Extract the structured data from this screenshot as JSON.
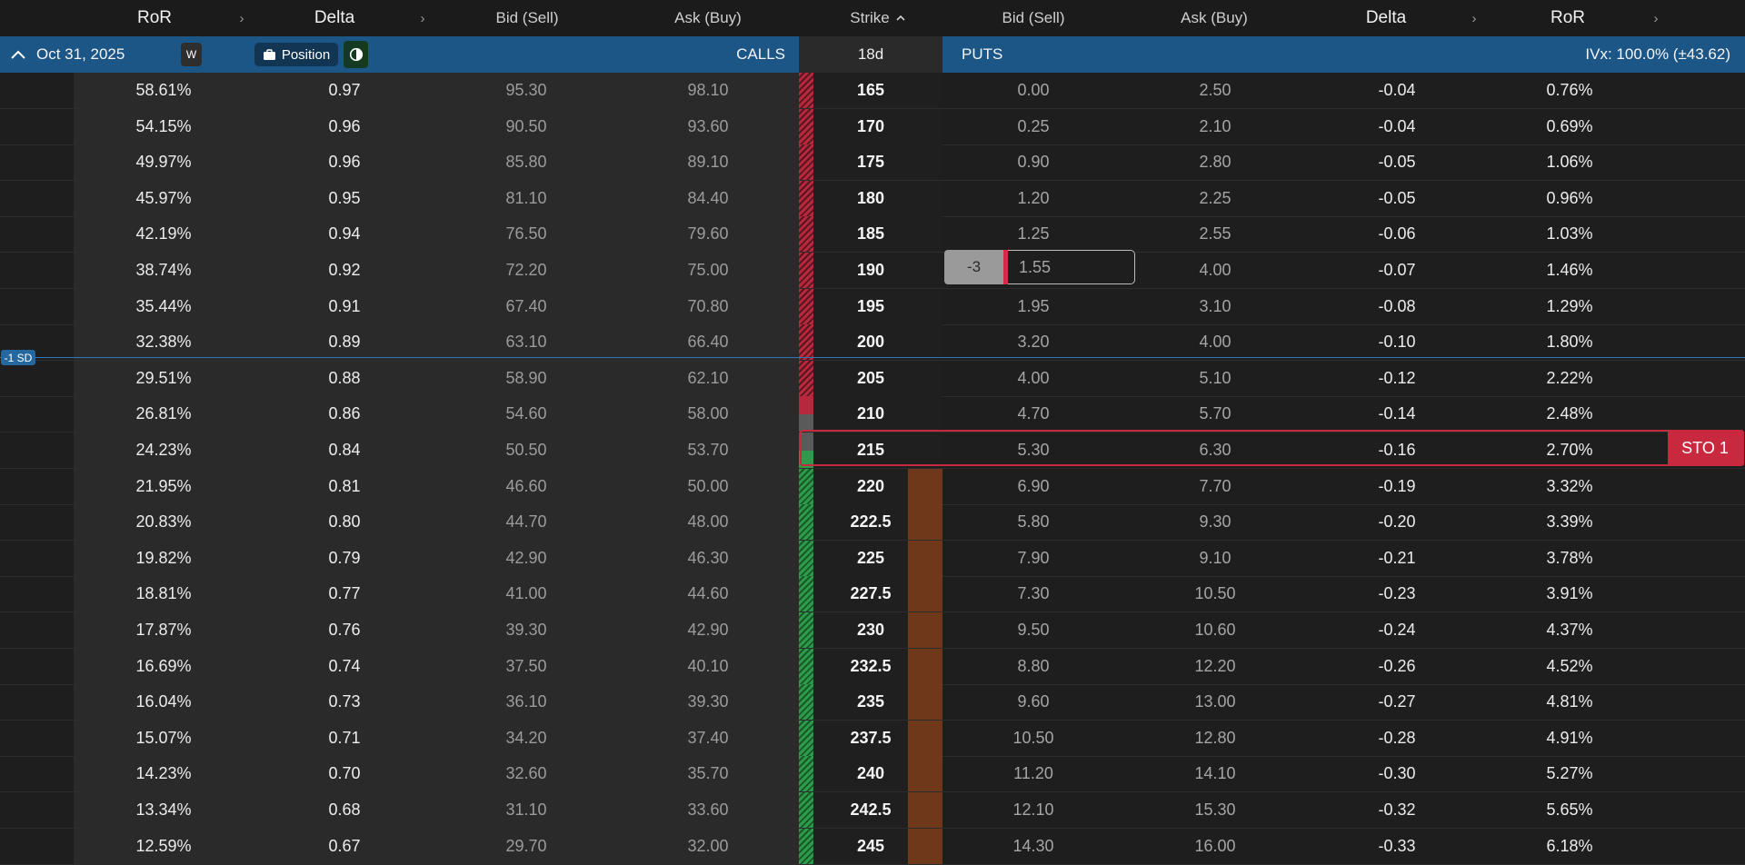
{
  "header": {
    "ror_left": "RoR",
    "delta_left": "Delta",
    "bid_left": "Bid (Sell)",
    "ask_left": "Ask (Buy)",
    "strike": "Strike",
    "strike_sort_icon": "chevron-up-icon",
    "bid_right": "Bid (Sell)",
    "ask_right": "Ask (Buy)",
    "delta_right": "Delta",
    "ror_right": "RoR",
    "arrow": "›"
  },
  "expiry_bar": {
    "collapse_icon": "chevron-up-icon",
    "date": "Oct 31, 2025",
    "weekly_badge": "W",
    "position_label": "Position",
    "contrast_icon": "contrast-icon",
    "calls_label": "CALLS",
    "days": "18d",
    "puts_label": "PUTS",
    "ivx": "IVx: 100.0% (±43.62)",
    "color": "#1c5687"
  },
  "sd_marker": "-1 SD",
  "order": {
    "quantity": "-3",
    "price": "1.55",
    "action": "STO 1"
  },
  "colors": {
    "itm_calls_hatch": "#b8283c",
    "otm_calls_hatch": "#2f9a4c",
    "position_bar": "#70381a",
    "selected_outline": "#c8293f"
  },
  "rows": [
    {
      "call_ror": "58.61%",
      "call_delta": "0.97",
      "call_bid": "95.30",
      "call_ask": "98.10",
      "strike": "165",
      "put_bid": "0.00",
      "put_ask": "2.50",
      "put_delta": "-0.04",
      "put_ror": "0.76%"
    },
    {
      "call_ror": "54.15%",
      "call_delta": "0.96",
      "call_bid": "90.50",
      "call_ask": "93.60",
      "strike": "170",
      "put_bid": "0.25",
      "put_ask": "2.10",
      "put_delta": "-0.04",
      "put_ror": "0.69%"
    },
    {
      "call_ror": "49.97%",
      "call_delta": "0.96",
      "call_bid": "85.80",
      "call_ask": "89.10",
      "strike": "175",
      "put_bid": "0.90",
      "put_ask": "2.80",
      "put_delta": "-0.05",
      "put_ror": "1.06%"
    },
    {
      "call_ror": "45.97%",
      "call_delta": "0.95",
      "call_bid": "81.10",
      "call_ask": "84.40",
      "strike": "180",
      "put_bid": "1.20",
      "put_ask": "2.25",
      "put_delta": "-0.05",
      "put_ror": "0.96%"
    },
    {
      "call_ror": "42.19%",
      "call_delta": "0.94",
      "call_bid": "76.50",
      "call_ask": "79.60",
      "strike": "185",
      "put_bid": "1.25",
      "put_ask": "2.55",
      "put_delta": "-0.06",
      "put_ror": "1.03%"
    },
    {
      "call_ror": "38.74%",
      "call_delta": "0.92",
      "call_bid": "72.20",
      "call_ask": "75.00",
      "strike": "190",
      "put_bid": "",
      "put_ask": "4.00",
      "put_delta": "-0.07",
      "put_ror": "1.46%"
    },
    {
      "call_ror": "35.44%",
      "call_delta": "0.91",
      "call_bid": "67.40",
      "call_ask": "70.80",
      "strike": "195",
      "put_bid": "1.95",
      "put_ask": "3.10",
      "put_delta": "-0.08",
      "put_ror": "1.29%"
    },
    {
      "call_ror": "32.38%",
      "call_delta": "0.89",
      "call_bid": "63.10",
      "call_ask": "66.40",
      "strike": "200",
      "put_bid": "3.20",
      "put_ask": "4.00",
      "put_delta": "-0.10",
      "put_ror": "1.80%"
    },
    {
      "call_ror": "29.51%",
      "call_delta": "0.88",
      "call_bid": "58.90",
      "call_ask": "62.10",
      "strike": "205",
      "put_bid": "4.00",
      "put_ask": "5.10",
      "put_delta": "-0.12",
      "put_ror": "2.22%"
    },
    {
      "call_ror": "26.81%",
      "call_delta": "0.86",
      "call_bid": "54.60",
      "call_ask": "58.00",
      "strike": "210",
      "put_bid": "4.70",
      "put_ask": "5.70",
      "put_delta": "-0.14",
      "put_ror": "2.48%"
    },
    {
      "call_ror": "24.23%",
      "call_delta": "0.84",
      "call_bid": "50.50",
      "call_ask": "53.70",
      "strike": "215",
      "put_bid": "5.30",
      "put_ask": "6.30",
      "put_delta": "-0.16",
      "put_ror": "2.70%"
    },
    {
      "call_ror": "21.95%",
      "call_delta": "0.81",
      "call_bid": "46.60",
      "call_ask": "50.00",
      "strike": "220",
      "put_bid": "6.90",
      "put_ask": "7.70",
      "put_delta": "-0.19",
      "put_ror": "3.32%"
    },
    {
      "call_ror": "20.83%",
      "call_delta": "0.80",
      "call_bid": "44.70",
      "call_ask": "48.00",
      "strike": "222.5",
      "put_bid": "5.80",
      "put_ask": "9.30",
      "put_delta": "-0.20",
      "put_ror": "3.39%"
    },
    {
      "call_ror": "19.82%",
      "call_delta": "0.79",
      "call_bid": "42.90",
      "call_ask": "46.30",
      "strike": "225",
      "put_bid": "7.90",
      "put_ask": "9.10",
      "put_delta": "-0.21",
      "put_ror": "3.78%"
    },
    {
      "call_ror": "18.81%",
      "call_delta": "0.77",
      "call_bid": "41.00",
      "call_ask": "44.60",
      "strike": "227.5",
      "put_bid": "7.30",
      "put_ask": "10.50",
      "put_delta": "-0.23",
      "put_ror": "3.91%"
    },
    {
      "call_ror": "17.87%",
      "call_delta": "0.76",
      "call_bid": "39.30",
      "call_ask": "42.90",
      "strike": "230",
      "put_bid": "9.50",
      "put_ask": "10.60",
      "put_delta": "-0.24",
      "put_ror": "4.37%"
    },
    {
      "call_ror": "16.69%",
      "call_delta": "0.74",
      "call_bid": "37.50",
      "call_ask": "40.10",
      "strike": "232.5",
      "put_bid": "8.80",
      "put_ask": "12.20",
      "put_delta": "-0.26",
      "put_ror": "4.52%"
    },
    {
      "call_ror": "16.04%",
      "call_delta": "0.73",
      "call_bid": "36.10",
      "call_ask": "39.30",
      "strike": "235",
      "put_bid": "9.60",
      "put_ask": "13.00",
      "put_delta": "-0.27",
      "put_ror": "4.81%"
    },
    {
      "call_ror": "15.07%",
      "call_delta": "0.71",
      "call_bid": "34.20",
      "call_ask": "37.40",
      "strike": "237.5",
      "put_bid": "10.50",
      "put_ask": "12.80",
      "put_delta": "-0.28",
      "put_ror": "4.91%"
    },
    {
      "call_ror": "14.23%",
      "call_delta": "0.70",
      "call_bid": "32.60",
      "call_ask": "35.70",
      "strike": "240",
      "put_bid": "11.20",
      "put_ask": "14.10",
      "put_delta": "-0.30",
      "put_ror": "5.27%"
    },
    {
      "call_ror": "13.34%",
      "call_delta": "0.68",
      "call_bid": "31.10",
      "call_ask": "33.60",
      "strike": "242.5",
      "put_bid": "12.10",
      "put_ask": "15.30",
      "put_delta": "-0.32",
      "put_ror": "5.65%"
    },
    {
      "call_ror": "12.59%",
      "call_delta": "0.67",
      "call_bid": "29.70",
      "call_ask": "32.00",
      "strike": "245",
      "put_bid": "14.30",
      "put_ask": "16.00",
      "put_delta": "-0.33",
      "put_ror": "6.18%"
    }
  ]
}
